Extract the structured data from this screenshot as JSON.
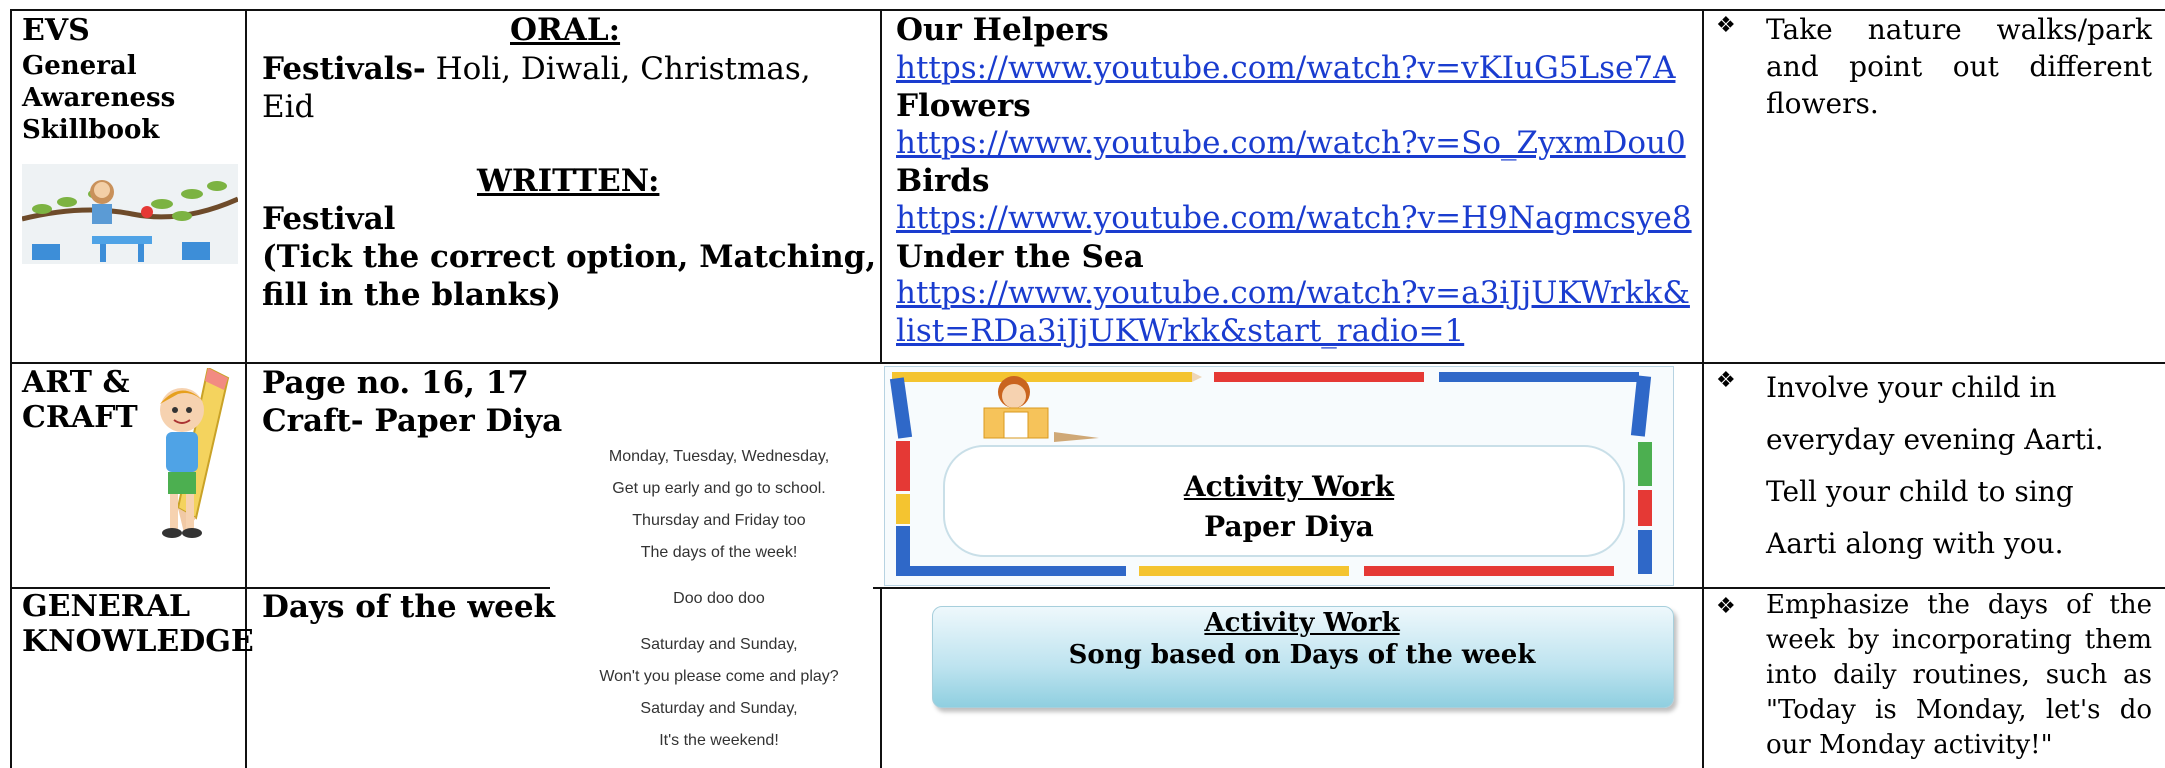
{
  "rows": {
    "evs": {
      "subject": "EVS",
      "subtitle_lines": [
        "General",
        "Awareness",
        "Skillbook"
      ],
      "oral_heading": "ORAL:",
      "festivals_label": "Festivals-",
      "festivals_text": " Holi, Diwali, Christmas,",
      "festivals_text2": "Eid",
      "written_heading": "WRITTEN:",
      "written_lines": [
        "Festival",
        "(Tick the correct option, Matching,",
        "fill in the blanks)"
      ],
      "resources": [
        {
          "title": "Our Helpers",
          "url": "https://www.youtube.com/watch?v=vKIuG5Lse7A"
        },
        {
          "title": "Flowers",
          "url": "https://www.youtube.com/watch?v=So_ZyxmDou0"
        },
        {
          "title": "Birds",
          "url": "https://www.youtube.com/watch?v=H9Nagmcsye8"
        },
        {
          "title": "Under the Sea",
          "url": "https://www.youtube.com/watch?v=a3iJjUKWrkk&",
          "url2": "list=RDa3iJjUKWrkk&start_radio=1"
        }
      ],
      "tip_lines": [
        "Take nature walks/park",
        "and point out different",
        "flowers."
      ]
    },
    "art": {
      "subject_lines": [
        "ART &",
        "CRAFT"
      ],
      "page_no": "Page no. 16, 17",
      "craft": "Craft- Paper Diya",
      "activity_title": "Activity Work",
      "activity_sub": "Paper Diya",
      "tip_lines": [
        "Involve your child in",
        "everyday evening Aarti.",
        "Tell your child to sing",
        "Aarti along with you."
      ]
    },
    "gk": {
      "subject_lines": [
        "GENERAL",
        "KNOWLEDGE"
      ],
      "topic": "Days of the week",
      "activity_title": "Activity Work",
      "activity_sub": "Song based on Days of the week",
      "tip_lines": [
        "Emphasize the days of the",
        "week by incorporating them",
        "into daily routines, such as",
        "\"Today is Monday, let's do",
        "our Monday activity!\""
      ]
    }
  },
  "song_lines": [
    "Monday, Tuesday, Wednesday,",
    "Get up early and go to school.",
    "Thursday and Friday too",
    "The days of the week!",
    "Doo doo doo",
    "Saturday and Sunday,",
    "Won't you please come and play?",
    "Saturday and Sunday,",
    "It's the weekend!"
  ],
  "bullet_glyph": "❖",
  "colors": {
    "link": "#1a3ccf",
    "border": "#111111",
    "banner_top": "#e8f6fb",
    "banner_bottom": "#8fcfe0"
  }
}
